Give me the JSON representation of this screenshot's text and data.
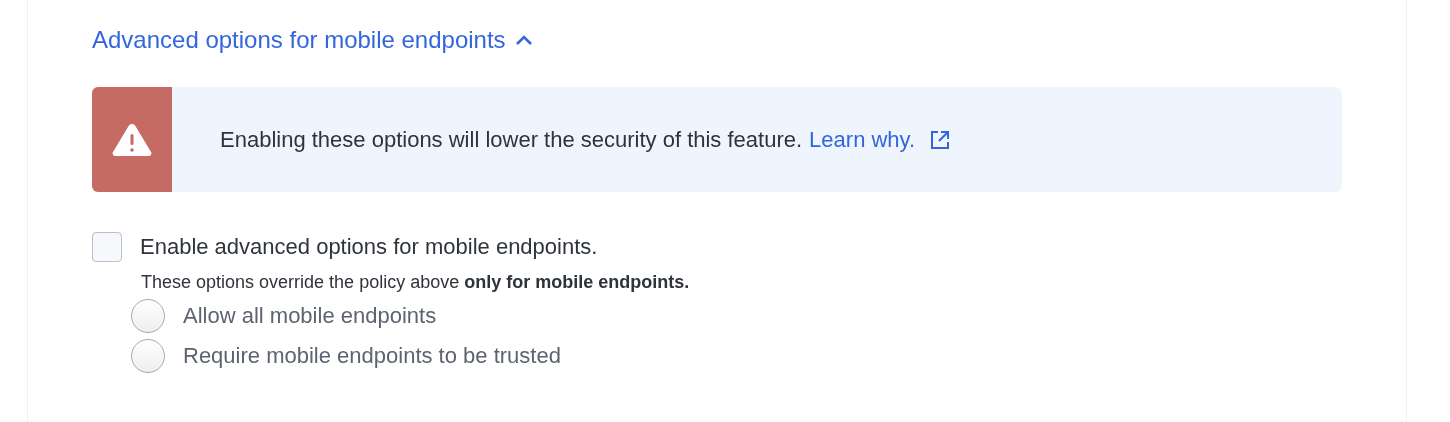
{
  "section": {
    "title": "Advanced options for mobile endpoints",
    "expanded": true
  },
  "warning": {
    "message": "Enabling these options will lower the security of this feature.",
    "link": "Learn why."
  },
  "enable_checkbox": {
    "label": "Enable advanced options for mobile endpoints.",
    "checked": false,
    "description": "These options override the policy above **only for mobile endpoints.**"
  },
  "options": [
    {
      "label": "Allow all mobile endpoints",
      "selected": false,
      "disabled": true
    },
    {
      "label": "Require mobile endpoints to be trusted",
      "selected": false,
      "disabled": true
    }
  ]
}
